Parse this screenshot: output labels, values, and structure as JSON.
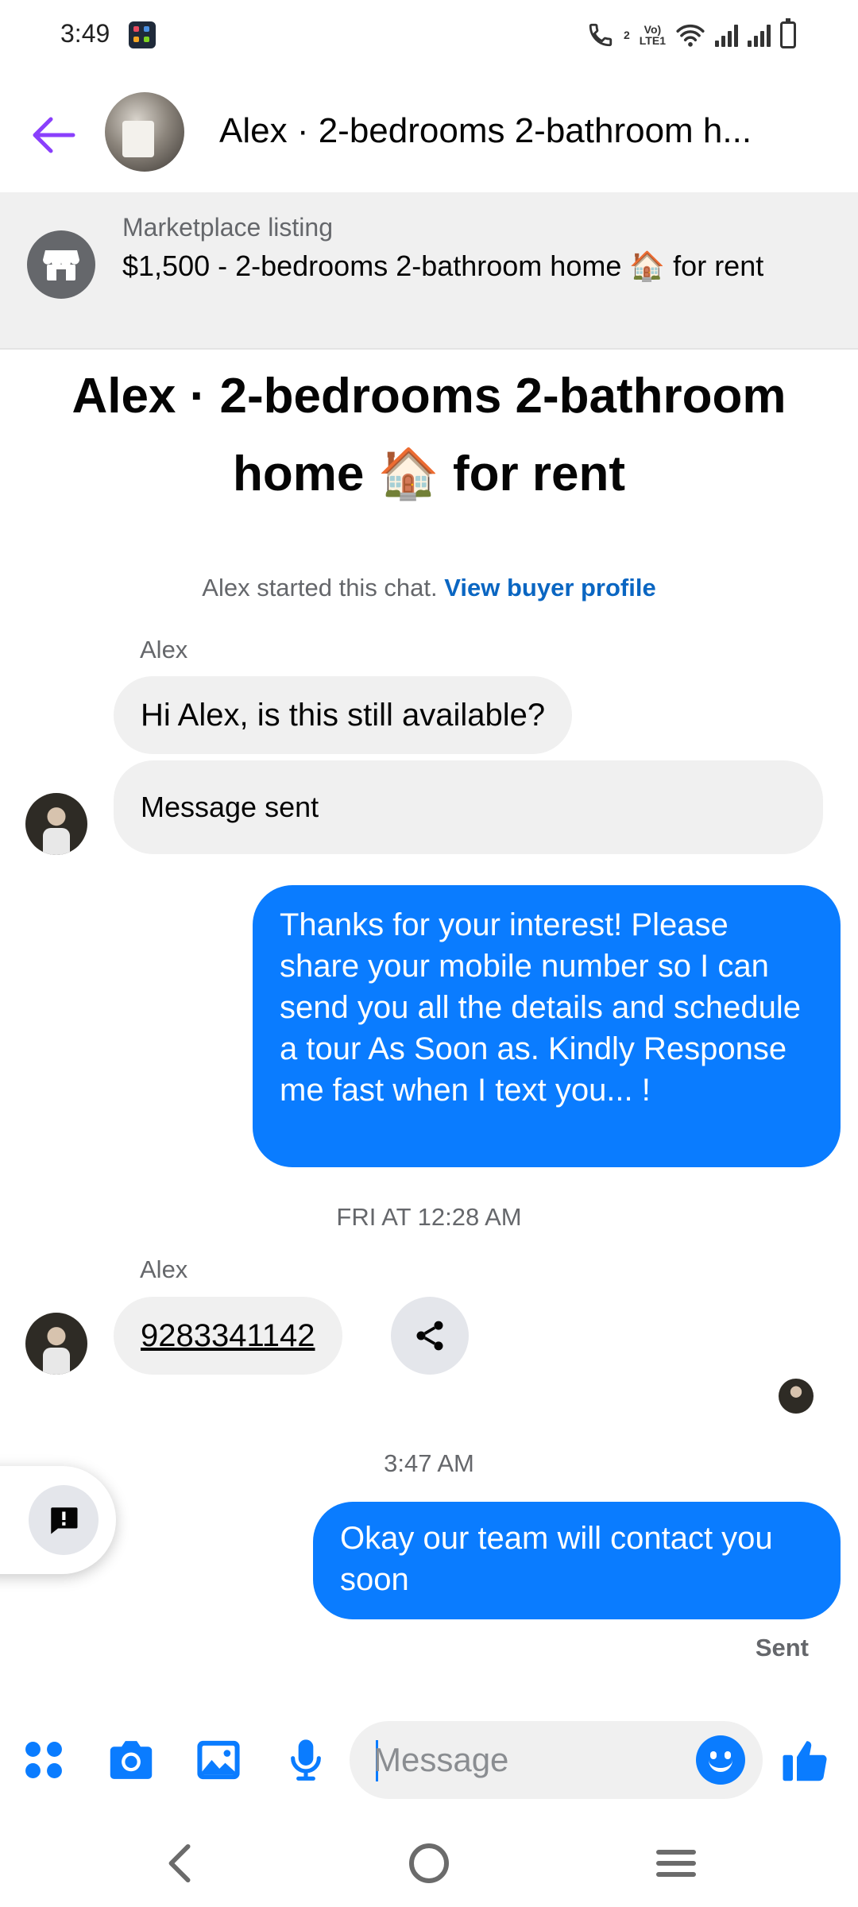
{
  "status_bar": {
    "time": "3:49",
    "network_top": "Vo)",
    "network_bottom": "LTE1",
    "sim_indicator": "2"
  },
  "header": {
    "back_icon": "arrow-left-icon",
    "title": "Alex · 2-bedrooms 2-bathroom h..."
  },
  "listing": {
    "label": "Marketplace listing",
    "title": "$1,500 - 2-bedrooms 2-bathroom home 🏠 for rent",
    "icon": "shop-icon"
  },
  "chat": {
    "title": "Alex · 2-bedrooms 2-bathroom home 🏠 for rent",
    "started_text": "Alex started this chat. ",
    "view_profile_link": "View buyer profile",
    "messages": [
      {
        "sender": "Alex",
        "text": "Hi Alex, is this still available?",
        "direction": "in"
      },
      {
        "text": "Message sent",
        "direction": "in"
      },
      {
        "text": "Thanks for your interest! Please share your mobile number so I can send you all the details and schedule a tour As Soon as. Kindly Response me fast when I text you... !",
        "direction": "out"
      },
      {
        "timestamp": "FRI AT 12:28 AM"
      },
      {
        "sender": "Alex",
        "text": "9283341142",
        "direction": "in"
      },
      {
        "timestamp": "3:47 AM"
      },
      {
        "text": "Okay our team will contact you soon",
        "direction": "out",
        "status": "Sent"
      }
    ]
  },
  "composer": {
    "placeholder": "Message",
    "tools": [
      "apps-icon",
      "camera-icon",
      "gallery-icon",
      "microphone-icon"
    ],
    "send_icon": "thumbs-up-icon",
    "emoji_icon": "emoji-icon"
  },
  "nav": {
    "buttons": [
      "back-nav-icon",
      "home-nav-icon",
      "recents-nav-icon"
    ]
  },
  "colors": {
    "accent": "#0a7cff",
    "back_arrow": "#8a3ffc",
    "link": "#0a66c2",
    "bubble_in": "#f0f0f0"
  }
}
